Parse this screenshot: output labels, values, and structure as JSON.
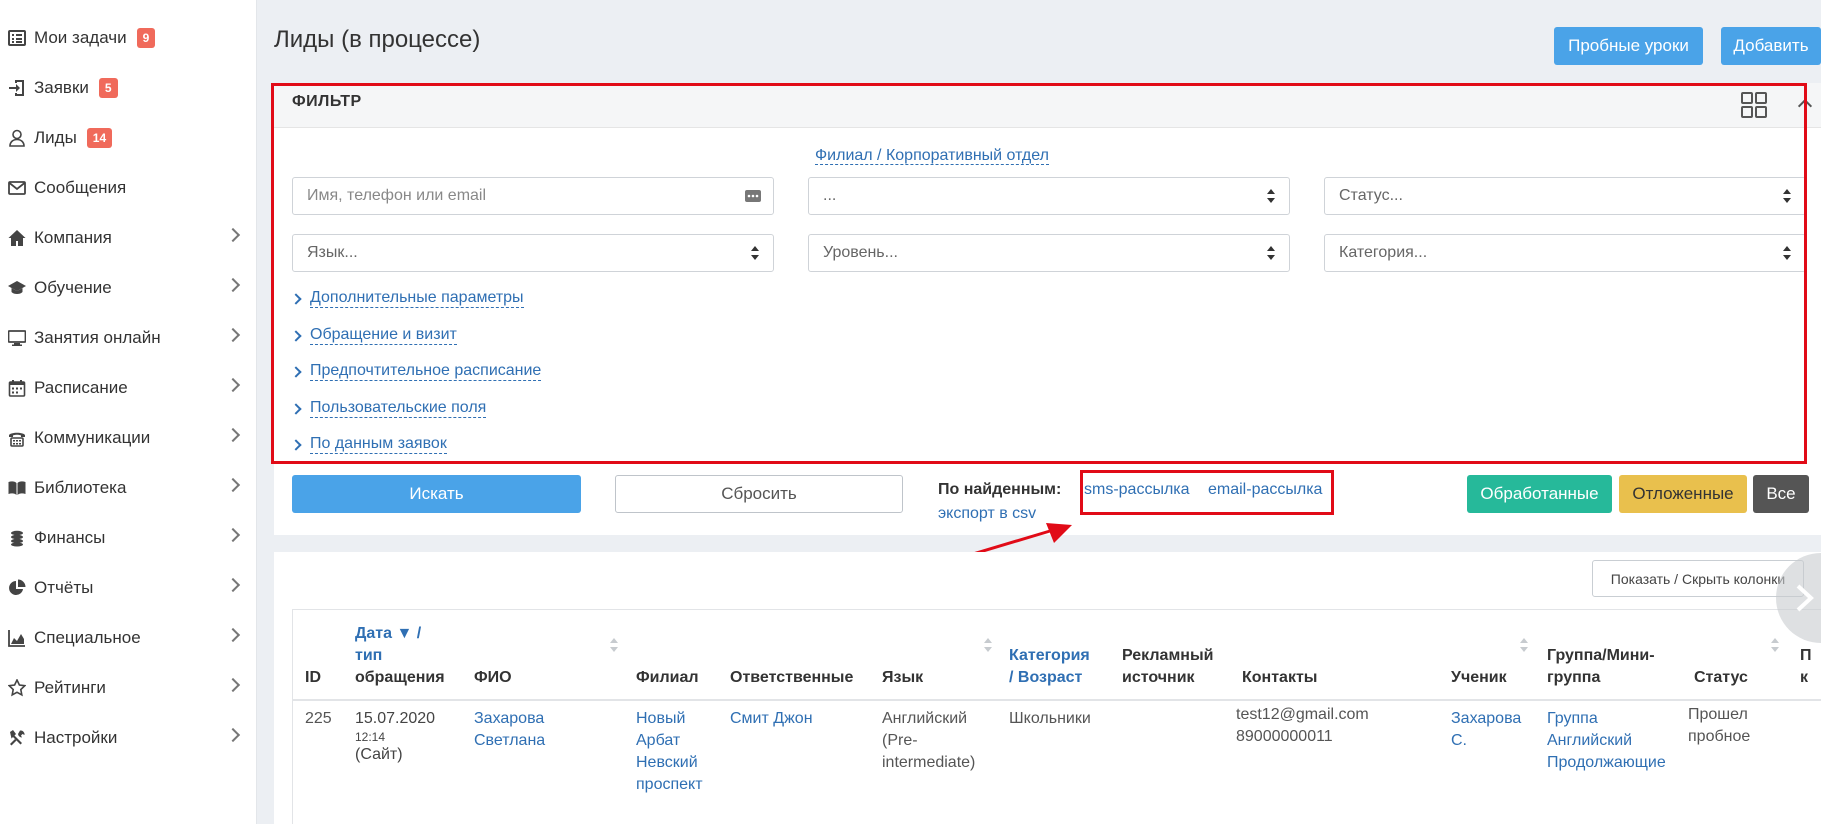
{
  "sidebar": {
    "items": [
      {
        "label": "Мои задачи",
        "icon": "tasks-list-icon",
        "badge": "9",
        "chevron": false
      },
      {
        "label": "Заявки",
        "icon": "sign-in-icon",
        "badge": "5",
        "chevron": false
      },
      {
        "label": "Лиды",
        "icon": "user-icon",
        "badge": "14",
        "chevron": false
      },
      {
        "label": "Сообщения",
        "icon": "envelope-icon",
        "badge": null,
        "chevron": false
      },
      {
        "label": "Компания",
        "icon": "home-icon",
        "badge": null,
        "chevron": true
      },
      {
        "label": "Обучение",
        "icon": "graduation-cap-icon",
        "badge": null,
        "chevron": true
      },
      {
        "label": "Занятия онлайн",
        "icon": "monitor-icon",
        "badge": null,
        "chevron": true
      },
      {
        "label": "Расписание",
        "icon": "calendar-icon",
        "badge": null,
        "chevron": true
      },
      {
        "label": "Коммуникации",
        "icon": "telephone-icon",
        "badge": null,
        "chevron": true
      },
      {
        "label": "Библиотека",
        "icon": "book-icon",
        "badge": null,
        "chevron": true
      },
      {
        "label": "Финансы",
        "icon": "coins-icon",
        "badge": null,
        "chevron": true
      },
      {
        "label": "Отчёты",
        "icon": "pie-chart-icon",
        "badge": null,
        "chevron": true
      },
      {
        "label": "Специальное",
        "icon": "area-chart-icon",
        "badge": null,
        "chevron": true
      },
      {
        "label": "Рейтинги",
        "icon": "star-icon",
        "badge": null,
        "chevron": true
      },
      {
        "label": "Настройки",
        "icon": "wrench-icon",
        "badge": null,
        "chevron": true
      }
    ]
  },
  "header": {
    "title": "Лиды (в процессе)",
    "trial_button": "Пробные уроки",
    "add_button": "Добавить"
  },
  "filter": {
    "title": "ФИЛЬТР",
    "branch_link": "Филиал / Корпоративный отдел",
    "search_placeholder": "Имя, телефон или email",
    "branch_select": "...",
    "status_select": "Статус...",
    "language_select": "Язык...",
    "level_select": "Уровень...",
    "category_select": "Категория...",
    "expanders": [
      "Дополнительные параметры",
      "Обращение и визит",
      "Предпочтительное расписание",
      "Пользовательские поля",
      "По данным заявок"
    ],
    "search_button": "Искать",
    "reset_button": "Сбросить",
    "found_label": "По найденным:",
    "sms_link": "sms-рассылка",
    "email_link": "email-рассылка",
    "csv_link": "экспорт в csv",
    "processed_button": "Обработанные",
    "postponed_button": "Отложенные",
    "all_button": "Все"
  },
  "table": {
    "toggle_columns_button": "Показать / Скрыть колонки",
    "headers": {
      "id": "ID",
      "date_1": "Дата ▼ /",
      "date_2": "тип",
      "date_3": "обращения",
      "fio": "ФИО",
      "branch": "Филиал",
      "responsible": "Ответственные",
      "language": "Язык",
      "category_1": "Категория",
      "category_2": "/ ",
      "category_3": "Возраст",
      "ad_1": "Рекламный",
      "ad_2": "источник",
      "contacts": "Контакты",
      "student": "Ученик",
      "group_1": "Группа/Мини-",
      "group_2": "группа",
      "status": "Статус",
      "extra_1": "П",
      "extra_2": "к"
    },
    "rows": [
      {
        "id": "225",
        "date": "15.07.2020",
        "time": "12:14",
        "type": "(Сайт)",
        "fio_1": "Захарова",
        "fio_2": "Светлана",
        "branch_1": "Новый",
        "branch_2": "Арбат",
        "branch_3": "Невский",
        "branch_4": "проспект",
        "responsible": "Смит Джон",
        "language_1": "Английский",
        "language_2": "(Pre-",
        "language_3": "intermediate)",
        "category": "Школьники",
        "email": "test12@gmail.com",
        "phone": "89000000011",
        "student_1": "Захарова",
        "student_2": "С.",
        "group_1": "Группа",
        "group_2": "Английский",
        "group_3": "Продолжающие",
        "status_1": "Прошел",
        "status_2": "пробное"
      }
    ]
  },
  "colors": {
    "accent_blue": "#4aa3e8",
    "link_blue": "#2f6fb3",
    "badge_red": "#f06a5b",
    "green": "#26b99a",
    "yellow": "#e9c04d",
    "dark": "#555555",
    "highlight_red": "#e10b17"
  }
}
